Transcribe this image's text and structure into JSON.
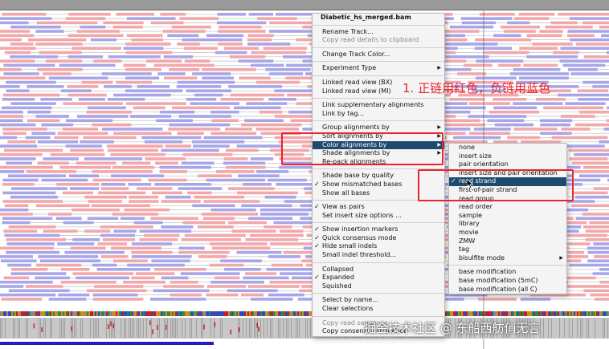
{
  "main_menu": {
    "title": "Diabetic_hs_merged.bam",
    "sections": [
      [
        {
          "label": "Rename Track..."
        },
        {
          "label": "Copy read details to clipboard",
          "disabled": true
        }
      ],
      [
        {
          "label": "Change Track Color..."
        }
      ],
      [
        {
          "label": "Experiment Type",
          "submenu": true
        }
      ],
      [
        {
          "label": "Linked read view (BX)"
        },
        {
          "label": "Linked read view (MI)"
        }
      ],
      [
        {
          "label": "Link supplementary alignments"
        },
        {
          "label": "Link by tag..."
        }
      ],
      [
        {
          "label": "Group alignments by",
          "submenu": true
        },
        {
          "label": "Sort alignments by",
          "submenu": true
        },
        {
          "label": "Color alignments by",
          "submenu": true,
          "highlighted": true
        },
        {
          "label": "Shade alignments by",
          "submenu": true
        },
        {
          "label": "Re-pack alignments"
        }
      ],
      [
        {
          "label": "Shade base by quality"
        },
        {
          "label": "Show mismatched bases",
          "checked": true
        },
        {
          "label": "Show all bases"
        }
      ],
      [
        {
          "label": "View as pairs",
          "checked": true
        },
        {
          "label": "Set insert size options ..."
        }
      ],
      [
        {
          "label": "Show insertion markers",
          "checked": true
        },
        {
          "label": "Quick consensus mode",
          "checked": true
        },
        {
          "label": "Hide small indels",
          "checked": true
        },
        {
          "label": "Small indel threshold..."
        }
      ],
      [
        {
          "label": "Collapsed"
        },
        {
          "label": "Expanded",
          "checked": true
        },
        {
          "label": "Squished"
        }
      ],
      [
        {
          "label": "Select by name..."
        },
        {
          "label": "Clear selections"
        }
      ],
      [
        {
          "label": "Copy read sequence",
          "disabled": true
        },
        {
          "label": "Copy consensus sequence"
        }
      ]
    ]
  },
  "color_submenu": {
    "sections": [
      [
        {
          "label": "none"
        },
        {
          "label": "insert size"
        },
        {
          "label": "pair orientation"
        },
        {
          "label": "insert size and pair orientation"
        },
        {
          "label": "read strand",
          "checked": true,
          "highlighted": true
        },
        {
          "label": "first-of-pair strand"
        },
        {
          "label": "read group"
        },
        {
          "label": "read order"
        },
        {
          "label": "sample"
        },
        {
          "label": "library"
        },
        {
          "label": "movie"
        },
        {
          "label": "ZMW"
        },
        {
          "label": "tag"
        },
        {
          "label": "bisulfite mode",
          "submenu": true
        }
      ],
      [
        {
          "label": "base modification"
        },
        {
          "label": "base modification (5mC)"
        },
        {
          "label": "base modification (all C)"
        }
      ]
    ]
  },
  "annotation": "1. 正链用红色，负链用蓝色",
  "watermark": "掘金技术社区 @ 东船西舫俏无言",
  "colors": {
    "forward_strand": "#f2a8ab",
    "reverse_strand": "#a8a6e8",
    "menu_highlight": "#1d4a6e",
    "annotation_red": "#e8242e"
  }
}
